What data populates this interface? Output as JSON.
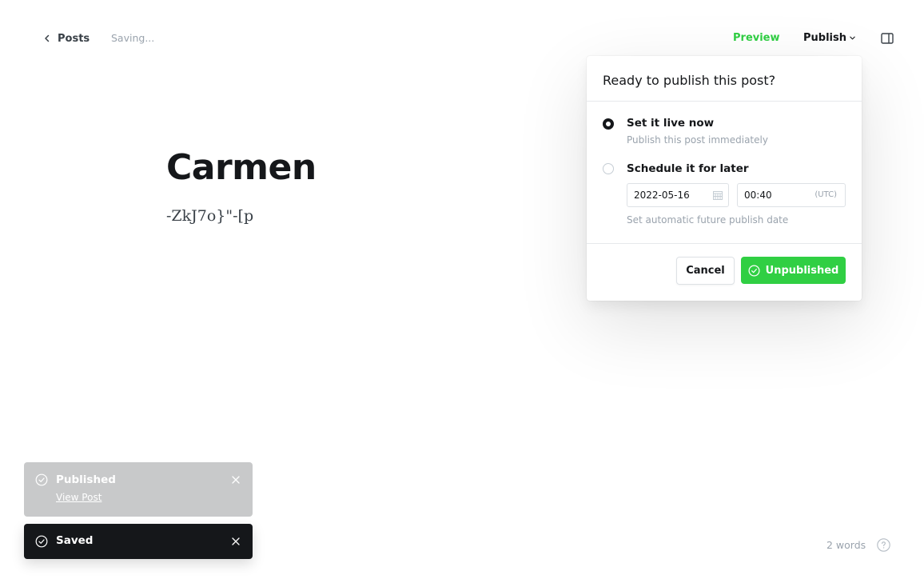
{
  "header": {
    "back_label": "Posts",
    "status": "Saving...",
    "preview_label": "Preview",
    "publish_label": "Publish"
  },
  "editor": {
    "title": "Carmen",
    "body": "-ZkJ7o}\"-[p"
  },
  "publish_menu": {
    "heading": "Ready to publish this post?",
    "option_now": {
      "title": "Set it live now",
      "description": "Publish this post immediately",
      "selected": true
    },
    "option_schedule": {
      "title": "Schedule it for later",
      "date": "2022-05-16",
      "time": "00:40",
      "timezone": "(UTC)",
      "hint": "Set automatic future publish date",
      "selected": false
    },
    "cancel_label": "Cancel",
    "confirm_label": "Unpublished"
  },
  "notifications": [
    {
      "title": "Published",
      "link_label": "View Post"
    },
    {
      "title": "Saved"
    }
  ],
  "footer": {
    "word_count": "2 words"
  },
  "colors": {
    "accent_green": "#30cf43",
    "dark": "#15171a",
    "muted": "#9aa3ad"
  },
  "icons": [
    "chevron-left-icon",
    "chevron-down-icon",
    "sidebar-toggle-icon",
    "calendar-icon",
    "check-circle-icon",
    "close-icon",
    "help-icon"
  ]
}
